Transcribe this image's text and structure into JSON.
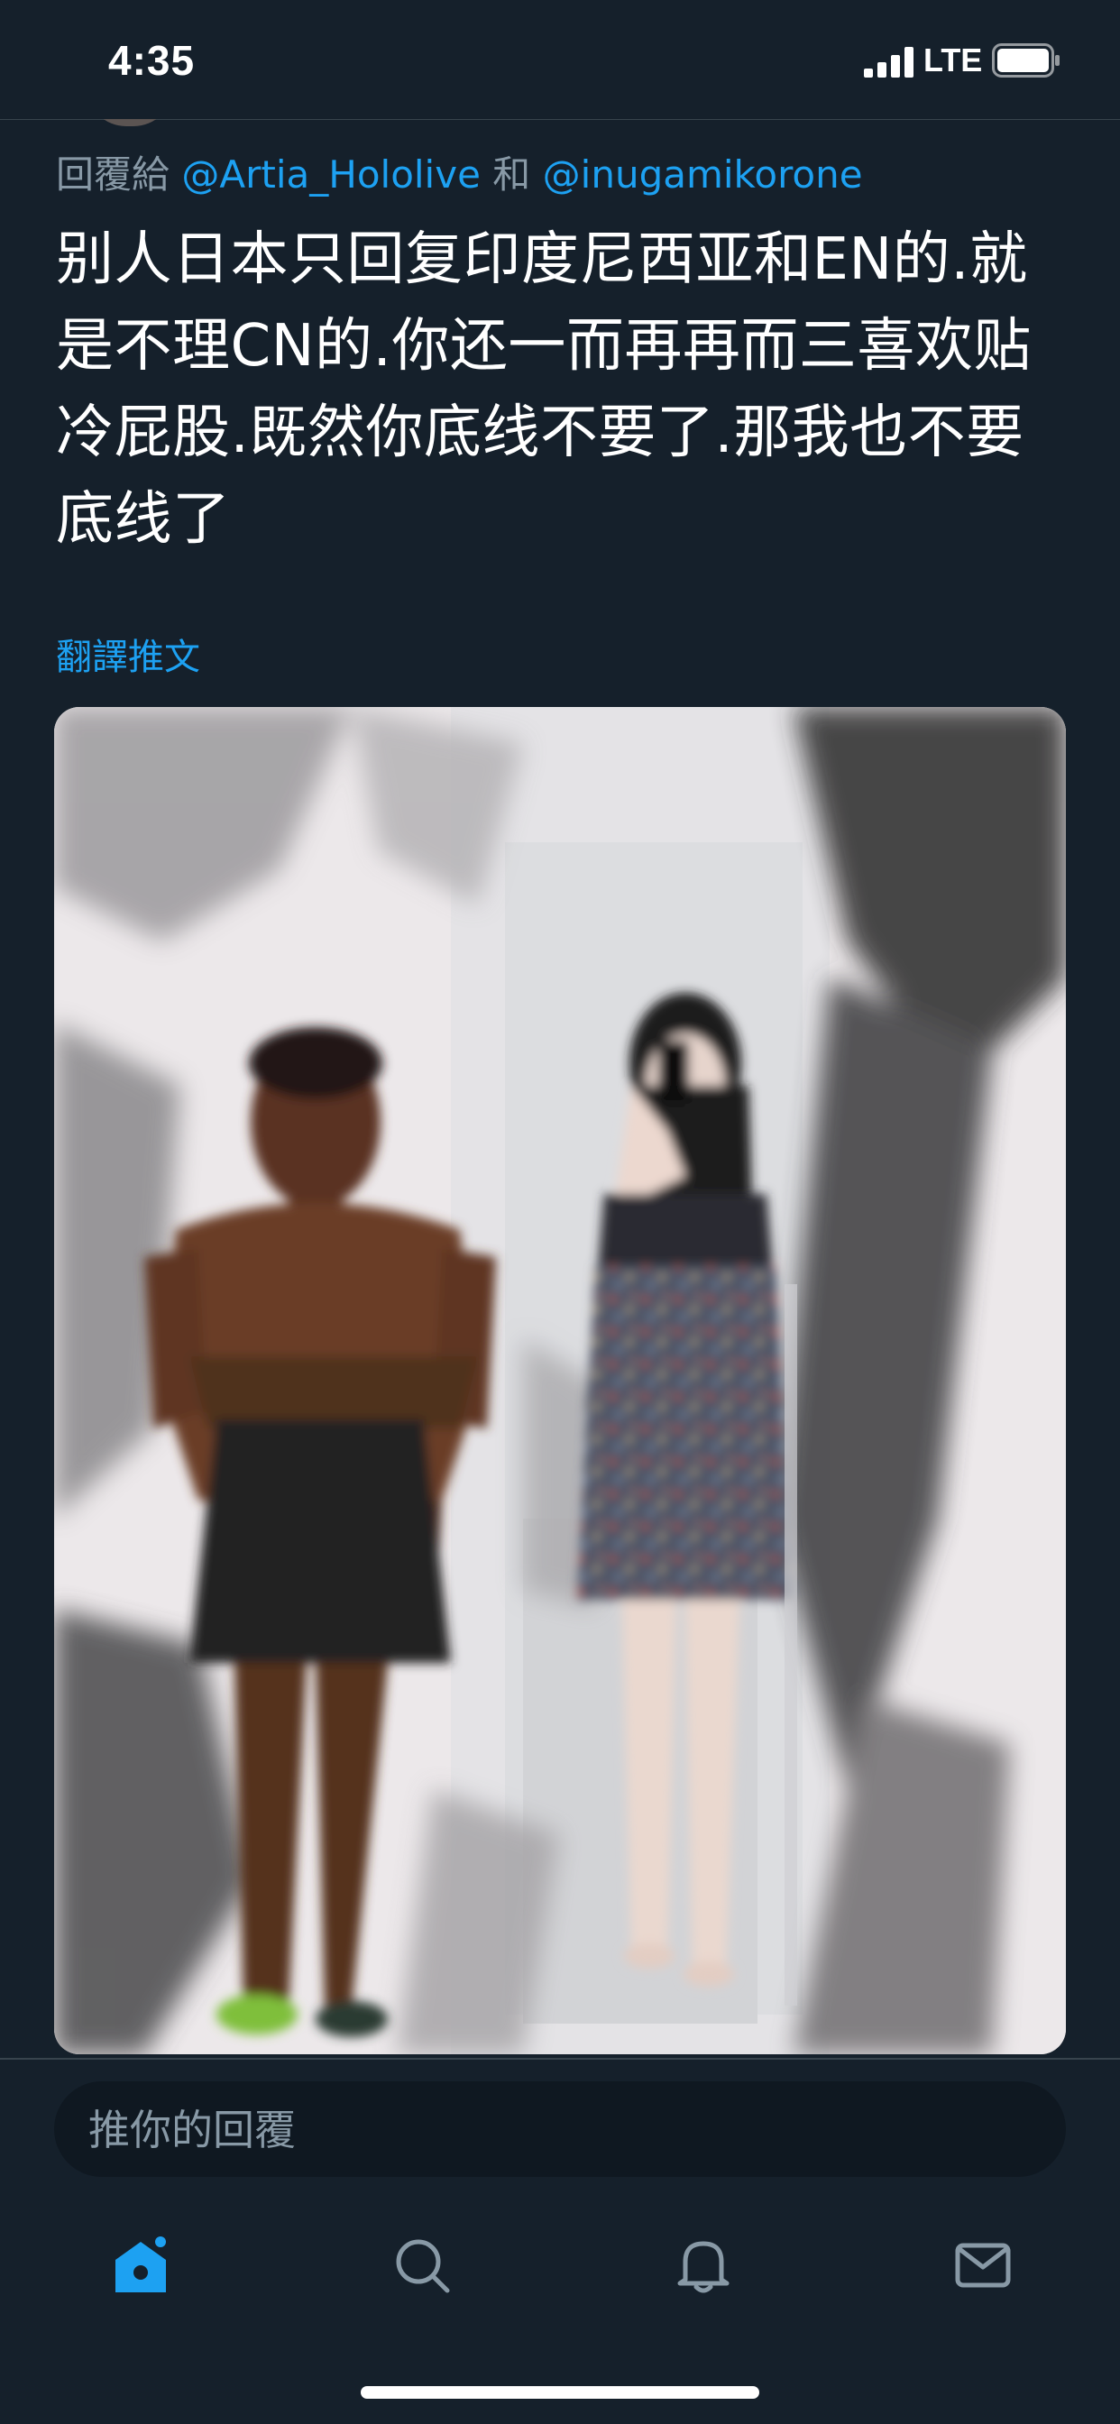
{
  "status_bar": {
    "time": "4:35",
    "network": "LTE",
    "signal_bars": 4,
    "battery_icon": "battery-full-icon"
  },
  "tweet": {
    "reply_prefix": "回覆給",
    "mention_1": "@Artia_Hololive",
    "conjunction": "和",
    "mention_2": "@inugamikorone",
    "text": "别人日本只回复印度尼西亚和EN的.就是不理CN的.你还一而再再而三喜欢贴冷屁股.既然你底线不要了.那我也不要底线了",
    "translate_label": "翻譯推文"
  },
  "reply": {
    "placeholder": "推你的回覆"
  },
  "tab_bar": {
    "active": "home",
    "tabs": [
      {
        "name": "home",
        "icon": "home-icon"
      },
      {
        "name": "search",
        "icon": "search-icon"
      },
      {
        "name": "notifications",
        "icon": "bell-icon"
      },
      {
        "name": "messages",
        "icon": "envelope-icon"
      }
    ]
  },
  "colors": {
    "background": "#15202b",
    "accent": "#1da1f2",
    "secondary_text": "#8899a6",
    "divider": "#38444d",
    "reply_box": "#0f1821"
  }
}
